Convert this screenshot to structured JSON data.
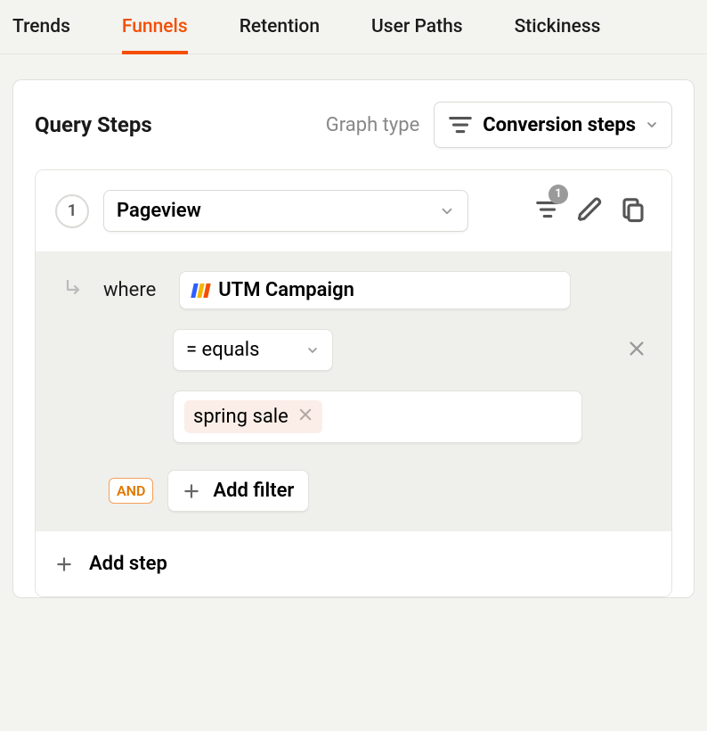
{
  "tabs": [
    "Trends",
    "Funnels",
    "Retention",
    "User Paths",
    "Stickiness"
  ],
  "activeTab": 1,
  "card": {
    "title": "Query Steps",
    "graphTypeLabel": "Graph type",
    "graphTypeValue": "Conversion steps"
  },
  "step": {
    "number": "1",
    "event": "Pageview",
    "filterBadge": "1"
  },
  "filter": {
    "whereLabel": "where",
    "property": "UTM Campaign",
    "operator": "= equals",
    "value": "spring sale",
    "andLabel": "AND",
    "addFilterLabel": "Add filter"
  },
  "addStepLabel": "Add step"
}
